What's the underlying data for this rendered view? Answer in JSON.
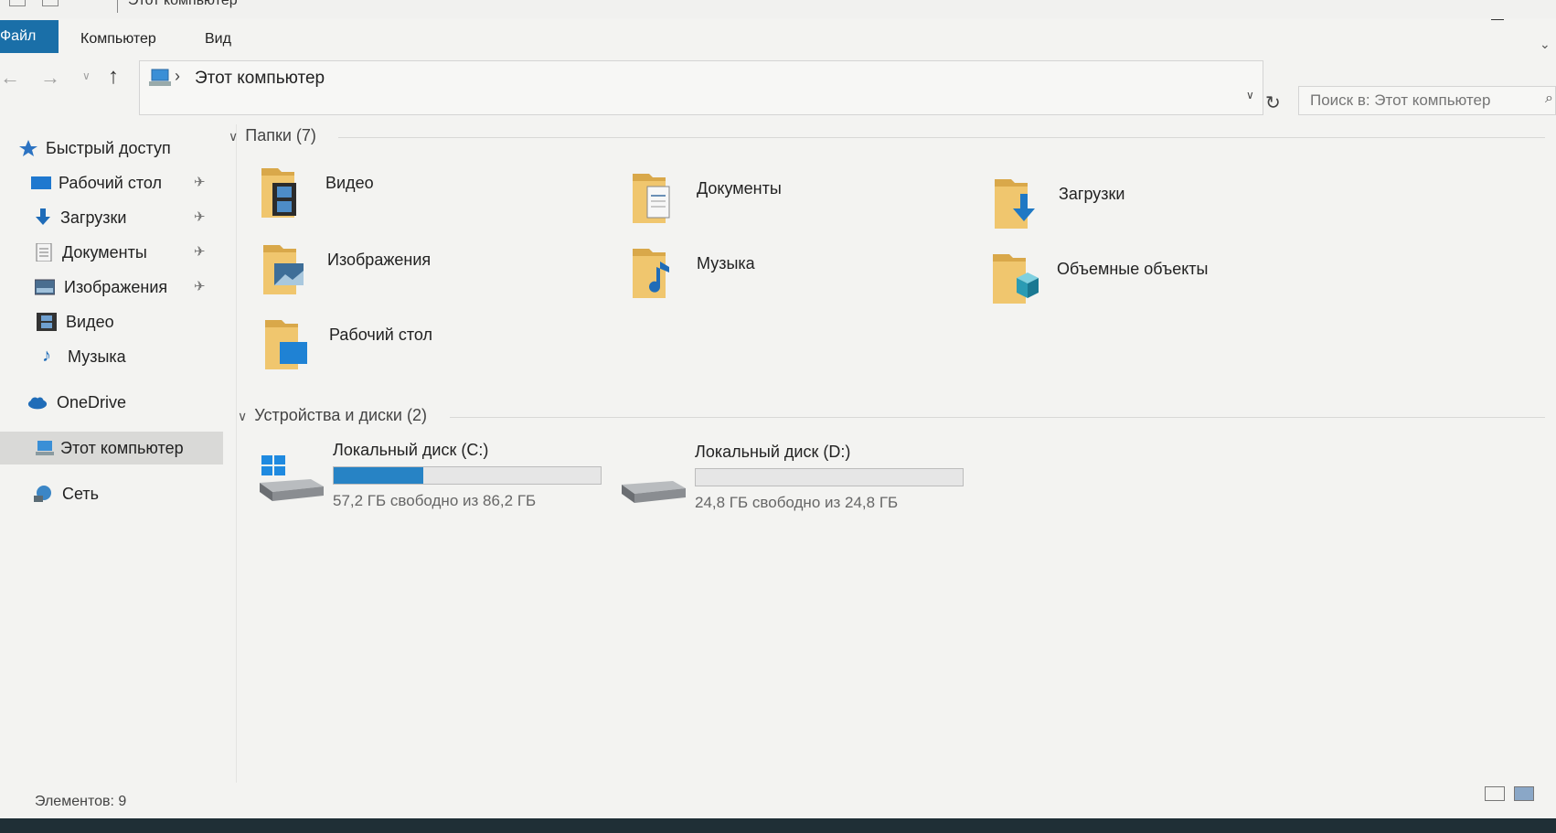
{
  "window": {
    "title": "Этот компьютер"
  },
  "ribbon": {
    "tabs": [
      {
        "label": "Файл",
        "active": true
      },
      {
        "label": "Компьютер",
        "active": false
      },
      {
        "label": "Вид",
        "active": false
      }
    ]
  },
  "address": {
    "path": "Этот компьютер",
    "search_placeholder": "Поиск в: Этот компьютер"
  },
  "sidebar": {
    "items": [
      {
        "label": "Быстрый доступ",
        "icon": "star-icon",
        "pinned": false
      },
      {
        "label": "Рабочий стол",
        "icon": "desktop-icon",
        "pinned": true
      },
      {
        "label": "Загрузки",
        "icon": "download-icon",
        "pinned": true
      },
      {
        "label": "Документы",
        "icon": "document-icon",
        "pinned": true
      },
      {
        "label": "Изображения",
        "icon": "image-icon",
        "pinned": true
      },
      {
        "label": "Видео",
        "icon": "video-icon",
        "pinned": false
      },
      {
        "label": "Музыка",
        "icon": "music-icon",
        "pinned": false
      },
      {
        "label": "OneDrive",
        "icon": "cloud-icon",
        "pinned": false
      },
      {
        "label": "Этот компьютер",
        "icon": "computer-icon",
        "pinned": false,
        "selected": true
      },
      {
        "label": "Сеть",
        "icon": "network-icon",
        "pinned": false
      }
    ]
  },
  "folders_group": {
    "header": "Папки (7)",
    "items": [
      {
        "label": "Видео",
        "icon": "video-folder-icon"
      },
      {
        "label": "Документы",
        "icon": "documents-folder-icon"
      },
      {
        "label": "Загрузки",
        "icon": "downloads-folder-icon"
      },
      {
        "label": "Изображения",
        "icon": "pictures-folder-icon"
      },
      {
        "label": "Музыка",
        "icon": "music-folder-icon"
      },
      {
        "label": "Объемные объекты",
        "icon": "3d-objects-folder-icon"
      },
      {
        "label": "Рабочий стол",
        "icon": "desktop-folder-icon"
      }
    ]
  },
  "drives_group": {
    "header": "Устройства и диски (2)",
    "items": [
      {
        "name": "Локальный диск (C:)",
        "free_text": "57,2 ГБ свободно из 86,2 ГБ",
        "used_fraction": 0.337,
        "system": true
      },
      {
        "name": "Локальный диск (D:)",
        "free_text": "24,8 ГБ свободно из 24,8 ГБ",
        "used_fraction": 0.0,
        "system": false
      }
    ]
  },
  "status": {
    "count": "Элементов: 9"
  },
  "colors": {
    "accent": "#1a6fa8",
    "drive_fill": "#2783c5",
    "folder_yellow": "#e8c06a"
  }
}
